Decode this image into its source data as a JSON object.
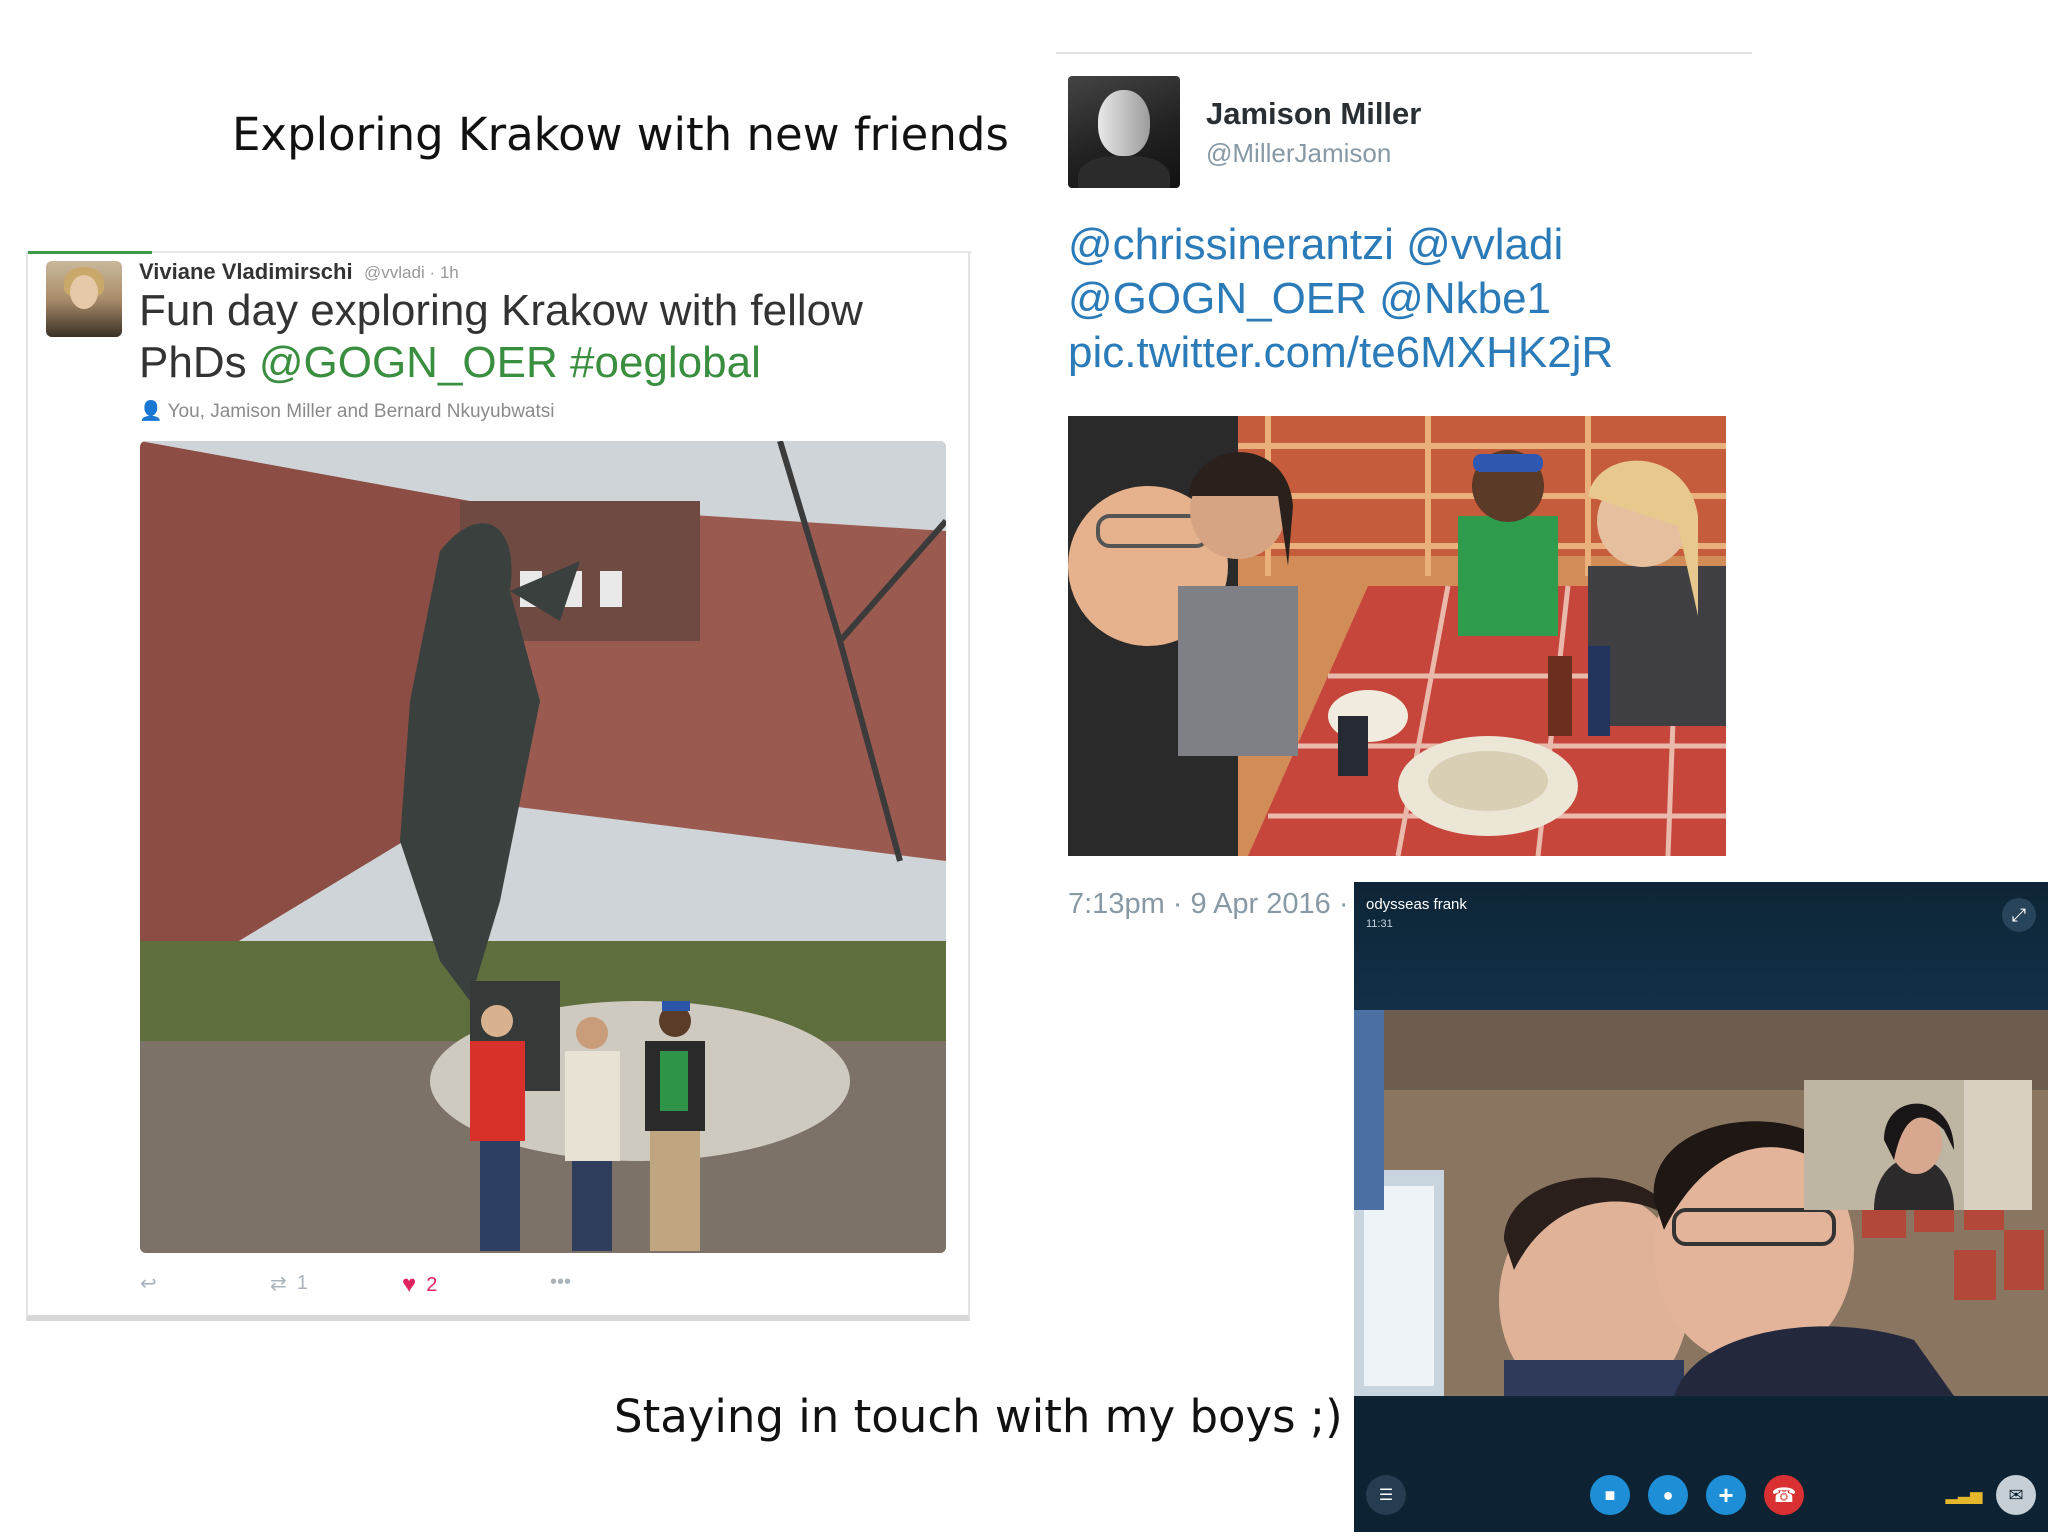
{
  "captions": {
    "top": "Exploring Krakow with new friends",
    "bottom": "Staying in touch with my boys ;)"
  },
  "tweet1": {
    "author_name": "Viviane Vladimirschi",
    "handle_time": "@vvladi · 1h",
    "text_plain": "Fun day exploring Krakow with fellow PhDs ",
    "text_mention": "@GOGN_OER",
    "text_hashtag": "#oeglobal",
    "tagged": "You, Jamison Miller and Bernard Nkuyubwatsi",
    "retweets": "1",
    "likes": "2",
    "colors": {
      "link": "#3a8e3f",
      "heart": "#e0245e"
    }
  },
  "tweet2": {
    "author_name": "Jamison Miller",
    "handle": "@MillerJamison",
    "text_line1": "@chrissinerantzi @vvladi",
    "text_line2": "@GOGN_OER @Nkbe1",
    "text_line3": "pic.twitter.com/te6MXHK2jR",
    "timestamp": "7:13pm · 9 Apr 2016 · ",
    "colors": {
      "link": "#2b7bb9"
    }
  },
  "skype": {
    "caller_name": "odysseas frank",
    "call_time": "11:31",
    "icons": [
      "expand-icon",
      "menu-icon",
      "video-icon",
      "mic-icon",
      "add-icon",
      "hangup-icon",
      "signal-icon",
      "chat-icon"
    ],
    "colors": {
      "blue": "#1e8fd7",
      "red": "#d93031"
    }
  }
}
